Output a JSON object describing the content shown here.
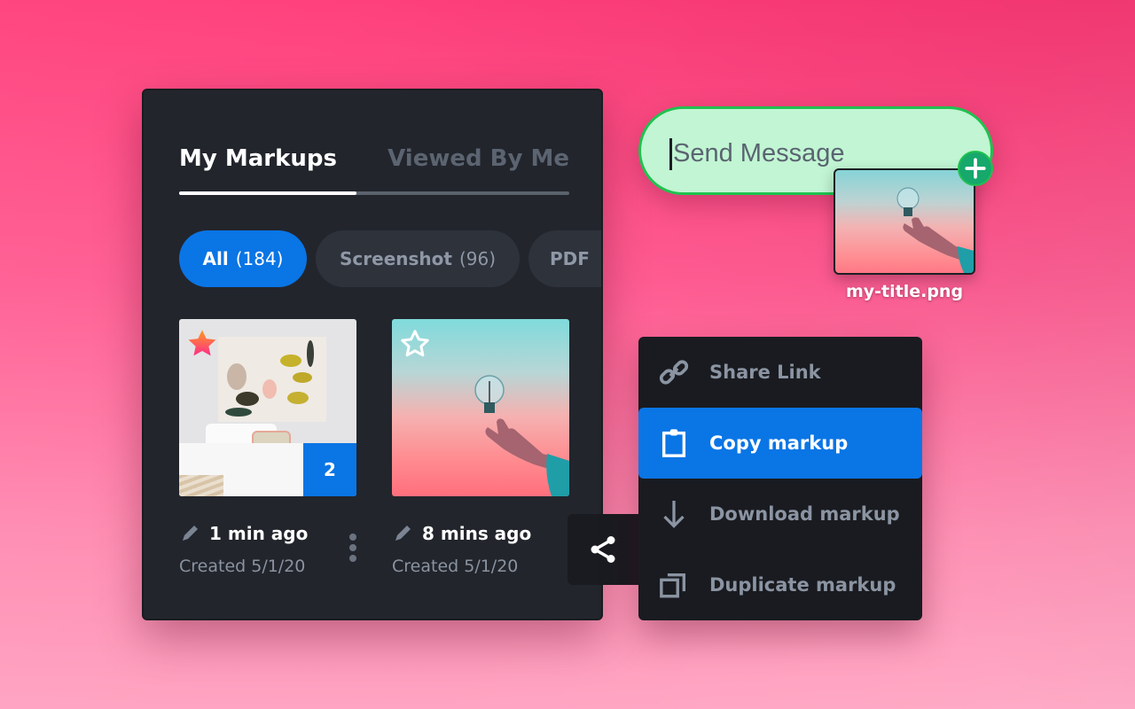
{
  "tabs": [
    {
      "label": "My Markups",
      "active": true
    },
    {
      "label": "Viewed By Me",
      "active": false
    }
  ],
  "filters": [
    {
      "label": "All",
      "count": "(184)",
      "active": true
    },
    {
      "label": "Screenshot",
      "count": "(96)",
      "active": false
    },
    {
      "label": "PDF",
      "count": "",
      "active": false
    }
  ],
  "cards": [
    {
      "thumbnail": "bedroom-art",
      "starred": true,
      "badge": "2",
      "edited": "1 min ago",
      "created": "Created 5/1/20",
      "edit_icon": "pencil-icon"
    },
    {
      "thumbnail": "hand-holding-lightbulb",
      "starred": false,
      "badge": null,
      "edited": "8 mins ago",
      "created": "Created 5/1/20",
      "edit_icon": "pencil-icon"
    }
  ],
  "context_menu": {
    "items": [
      {
        "label": "Share Link",
        "icon": "link-icon",
        "active": false
      },
      {
        "label": "Copy markup",
        "icon": "clipboard-icon",
        "active": true
      },
      {
        "label": "Download markup",
        "icon": "arrow-down-icon",
        "active": false
      },
      {
        "label": "Duplicate markup",
        "icon": "duplicate-icon",
        "active": false
      }
    ]
  },
  "share_button": {
    "icon": "share-icon"
  },
  "message": {
    "placeholder": "Send Message",
    "value": "",
    "attach_icon": "plus-icon"
  },
  "dragged_file": {
    "name": "my-title.png",
    "thumbnail": "hand-holding-lightbulb"
  },
  "colors": {
    "accent": "#0a75e5",
    "panel_bg": "#22252c",
    "menu_bg": "#191b20",
    "message_bg": "#c1f5d3",
    "message_border": "#1fc24f",
    "plus_bg": "#17a86c",
    "background_top": "#ff3a78",
    "background_bottom": "#ffa4c2"
  }
}
